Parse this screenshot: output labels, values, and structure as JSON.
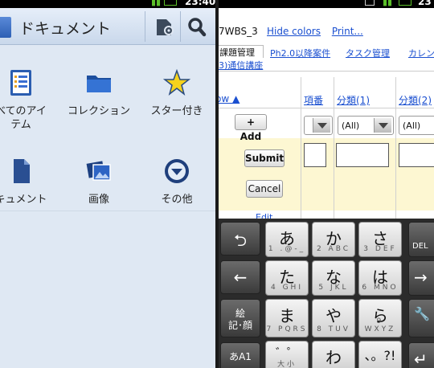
{
  "left": {
    "status_time": "23:40",
    "title": "ドキュメント",
    "items": [
      {
        "icon": "list-icon",
        "label": "べてのアイ\nテム"
      },
      {
        "icon": "folder-icon",
        "label": "コレクション"
      },
      {
        "icon": "star-icon",
        "label": "スター付き"
      },
      {
        "icon": "document-icon",
        "label": "キュメント"
      },
      {
        "icon": "image-icon",
        "label": "画像"
      },
      {
        "icon": "more-icon",
        "label": "その他"
      }
    ]
  },
  "right": {
    "status_time": "23",
    "project_id": "7WBS_3",
    "top_links": [
      "Hide colors",
      "Print..."
    ],
    "tabs": {
      "active": "課題管理",
      "others": [
        "Ph2.0以降案件",
        "タスク管理",
        "カレン"
      ],
      "row2": "3)通信講座"
    },
    "columns": [
      "ow ▲",
      "項番",
      "分類(1)",
      "分類(2)"
    ],
    "add_label": "+ Add",
    "filter_values": [
      "",
      "(All)",
      "(All)"
    ],
    "submit_label": "Submit",
    "cancel_label": "Cancel",
    "edit_label": "Edit",
    "keyboard": {
      "keys": [
        {
          "kana": "あ",
          "sub": "1 .@-_"
        },
        {
          "kana": "か",
          "sub": "2 ABC"
        },
        {
          "kana": "さ",
          "sub": "3 DEF"
        },
        {
          "kana": "た",
          "sub": "4 GHI"
        },
        {
          "kana": "な",
          "sub": "5 JKL"
        },
        {
          "kana": "は",
          "sub": "6 MNO"
        },
        {
          "kana": "ま",
          "sub": "7 PQRS"
        },
        {
          "kana": "や",
          "sub": "8 TUV"
        },
        {
          "kana": "ら",
          "sub": "9 WXYZ"
        },
        {
          "kana": "゛゜",
          "sub": "大小"
        },
        {
          "kana": "わ",
          "sub": ""
        },
        {
          "kana": "、。?!",
          "sub": ""
        }
      ],
      "left_keys": [
        "⮌",
        "←",
        "絵\n記･顔",
        "あA1"
      ],
      "right_keys": [
        "DEL",
        "→",
        "🔧",
        "↵"
      ]
    }
  },
  "colors": {
    "left_bg": "#dfe8f3",
    "link": "#1a4fd0",
    "highlight_row": "#fdf7d2",
    "status_green": "#5bbf2a"
  }
}
